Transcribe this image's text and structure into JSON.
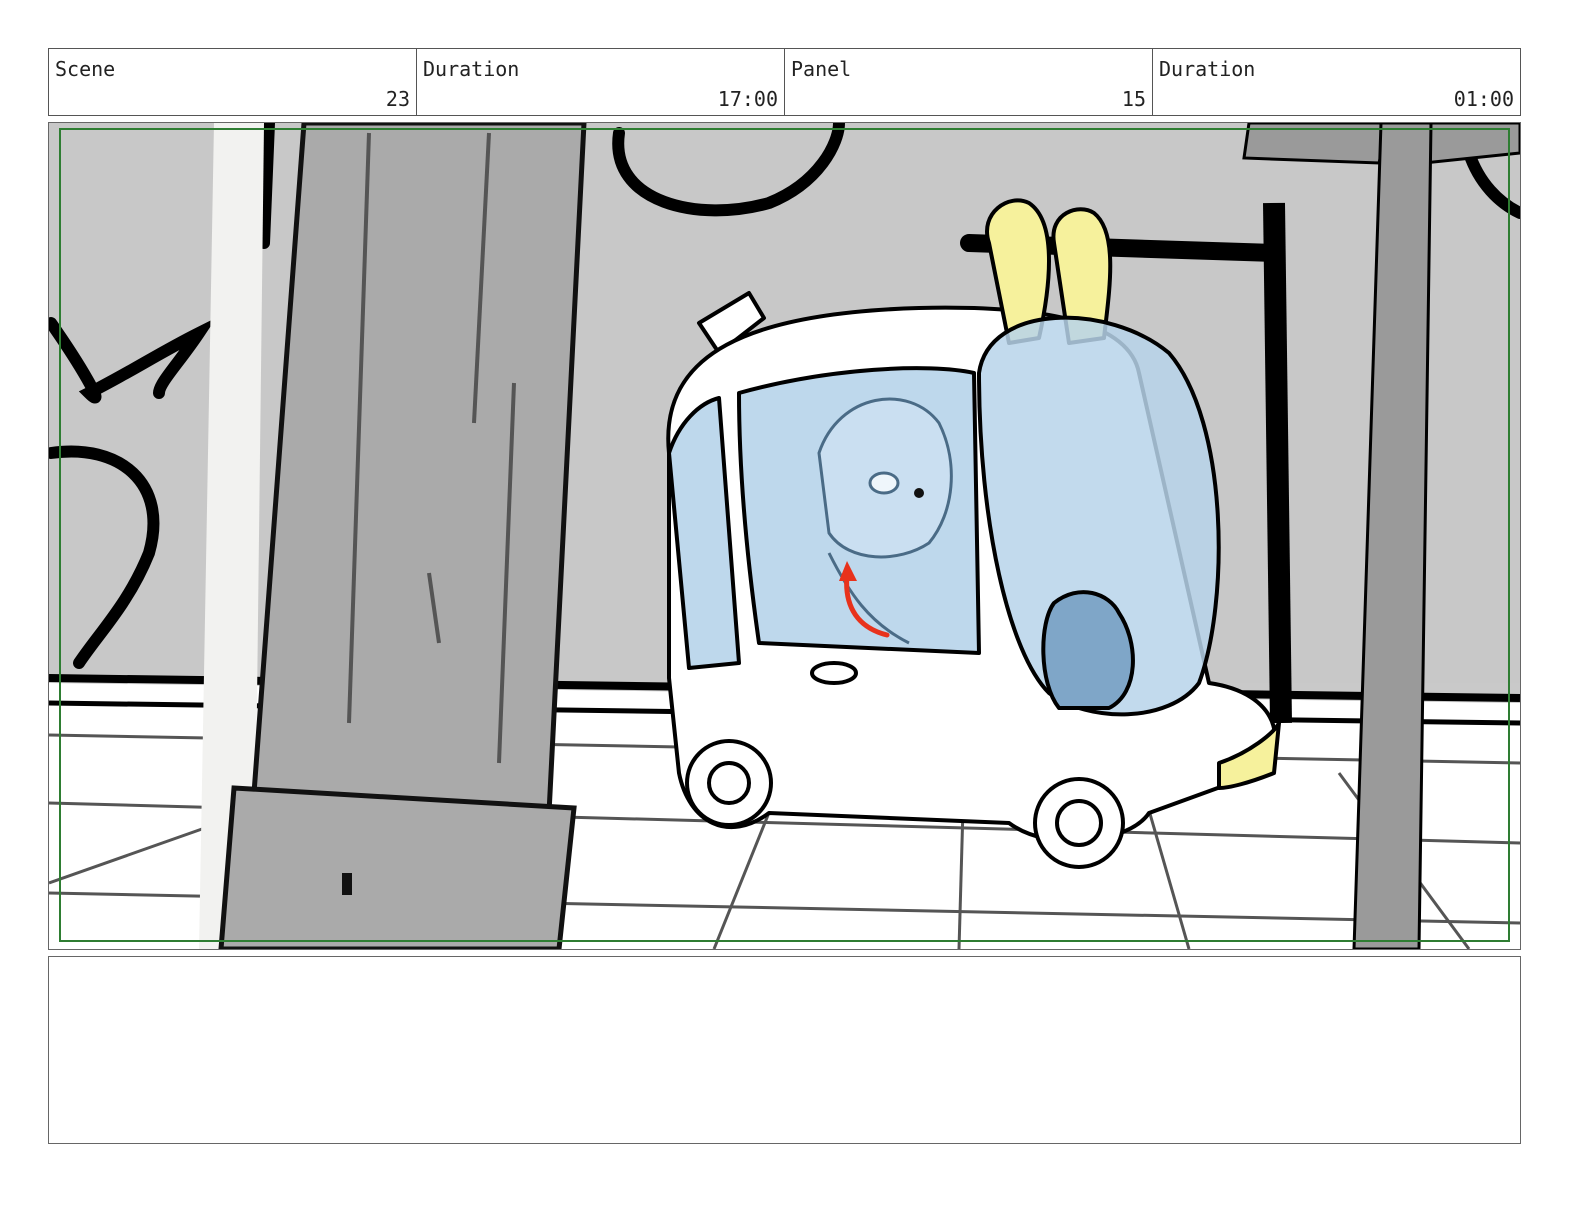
{
  "header": {
    "scene_label": "Scene",
    "scene_value": "23",
    "duration_label": "Duration",
    "duration_value": "17:00",
    "panel_label": "Panel",
    "panel_value": "15",
    "panel_duration_label": "Duration",
    "panel_duration_value": "01:00"
  },
  "artwork": {
    "safe_frame_color": "#2e7d32",
    "action_arrow_color": "#e8321c",
    "glass_tint_color": "#b7d4ea",
    "ear_fill_color": "#f6f19c"
  },
  "notes": {
    "text": ""
  }
}
